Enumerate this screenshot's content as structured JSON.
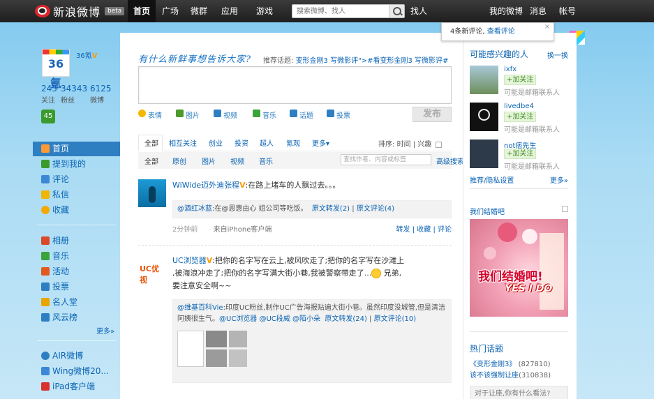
{
  "topbar": {
    "logo_text": "新浪微博",
    "beta": "beta",
    "nav": [
      "首页",
      "广场",
      "微群",
      "应用",
      "游戏"
    ],
    "search_placeholder": "搜索微博、找人",
    "find_people": "找人",
    "right_links": [
      "我的微博",
      "消息",
      "帐号"
    ]
  },
  "notify": {
    "text": "4条新评论,",
    "link": "查看评论",
    "close": "×"
  },
  "profile": {
    "avatar_text": "36氪",
    "name": "36氪",
    "v": "V",
    "stats": [
      {
        "n": "243",
        "l": "关注"
      },
      {
        "n": "34343",
        "l": "粉丝"
      },
      {
        "n": "6125",
        "l": "微博"
      }
    ],
    "badge": "45"
  },
  "left_nav": [
    {
      "label": "首页",
      "color": "#ff9933"
    },
    {
      "label": "提到我的",
      "color": "#3a9a2c"
    },
    {
      "label": "评论",
      "color": "#3c88d6"
    },
    {
      "label": "私信",
      "color": "#f0b500"
    },
    {
      "label": "收藏",
      "color": "#f5a900"
    },
    {
      "label": "相册",
      "color": "#d84a2a"
    },
    {
      "label": "音乐",
      "color": "#3aa43a"
    },
    {
      "label": "活动",
      "color": "#e05a20"
    },
    {
      "label": "投票",
      "color": "#2e7fc2"
    },
    {
      "label": "名人堂",
      "color": "#e8a400"
    },
    {
      "label": "风云榜",
      "color": "#2e7fc2"
    },
    {
      "label": "AIR微博",
      "color": "#2e7fc2"
    },
    {
      "label": "Wing微博20...",
      "color": "#3c88d6"
    },
    {
      "label": "iPad客户端",
      "color": "#d93030"
    }
  ],
  "left_more": "更多»",
  "compose": {
    "ask": "有什么新鲜事想告诉大家?",
    "hot_label": "推荐话题:",
    "hot_topic": "变形金刚3 写微影评\">#看变形金刚3 写微影评#",
    "tools": [
      {
        "label": "表情",
        "color": "#f5b800"
      },
      {
        "label": "图片",
        "color": "#4a9a2c"
      },
      {
        "label": "视频",
        "color": "#2e7fc2"
      },
      {
        "label": "音乐",
        "color": "#3aa43a"
      },
      {
        "label": "话题",
        "color": "#2e7fc2"
      },
      {
        "label": "投票",
        "color": "#2e7fc2"
      }
    ],
    "publish": "发布"
  },
  "tabs1": [
    "全部",
    "相互关注",
    "创业",
    "投资",
    "超人",
    "氪观",
    "更多▾"
  ],
  "sort": {
    "label": "排序:",
    "time": "时间",
    "interest": "兴趣"
  },
  "tabs2": [
    "全部",
    "原创",
    "图片",
    "视频",
    "音乐"
  ],
  "filter_placeholder": "查找作者、内容或标签",
  "adv_search": "高级搜索",
  "feeds": [
    {
      "nick": "WiWide迈外迪张程",
      "v": "V",
      "text": ":在路上堵车的人飘过去。。。",
      "quote": {
        "nick": "@酒红冰蓝",
        "text": ":在@恩惠由心 姐公司等吃饭。",
        "repost": "原文转发(2)",
        "comment": "原文评论(4)"
      },
      "time": "2分钟前",
      "source": "来自iPhone客户端",
      "actions": "转发 | 收藏 | 评论"
    },
    {
      "nick": "UC浏览器",
      "v": "V",
      "text1": ":把你的名字写在云上,被风吹走了;把你的名字写在沙滩上",
      "text2": ",被海浪冲走了;把你的名字写满大街小巷,我被警察带走了...",
      "text3": "兄弟,",
      "text4": "要注意安全啊~~",
      "quote": {
        "nick": "@维基百科Vie",
        "text": ":印度UC粉丝,制作UC广告海报贴遍大街小巷。虽然印度没城管,但是清洁阿姨很生气。",
        "mentions": "@UC浏览器 @UC段威 @陌小朵",
        "repost": "原文转发(24)",
        "comment": "原文评论(10)"
      },
      "avatar_text": "UC优视"
    }
  ],
  "right": {
    "title": "可能感兴趣的人",
    "change": "换一换",
    "suggestions": [
      {
        "name": "ixfx",
        "follow": "+加关注",
        "rel": "可能是邮箱联系人"
      },
      {
        "name": "livedbe4",
        "follow": "+加关注",
        "rel": "可能是邮箱联系人"
      },
      {
        "name": "not痞先生",
        "follow": "+加关注",
        "rel": "可能是邮箱联系人"
      }
    ],
    "rec_setting": "推荐/隐私设置",
    "rec_more": "更多»",
    "ad_title": "我们结婚吧",
    "ad_headline": "我们结婚吧!",
    "ad_sub": "YES I DO",
    "hot_title": "热门话题",
    "hot_topics": [
      {
        "t": "《变形金刚3》",
        "c": "(827810)"
      },
      {
        "t": "该不该强制让座",
        "c": "(310838)"
      }
    ],
    "hot_ask": "对于让座,你有什么看法?"
  }
}
